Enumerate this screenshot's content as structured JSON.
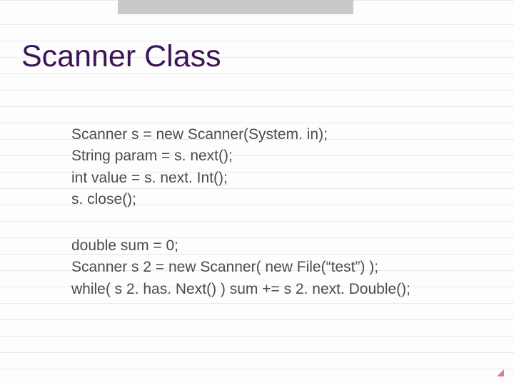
{
  "title": "Scanner Class",
  "code1": {
    "l1": "Scanner s = new Scanner(System. in);",
    "l2": "String param = s. next();",
    "l3": "int value = s. next. Int();",
    "l4": "s. close();"
  },
  "code2": {
    "l1": "double sum = 0;",
    "l2": "Scanner s 2 = new Scanner( new File(“test”) );",
    "l3": "while( s 2. has. Next() ) sum += s 2. next. Double();"
  }
}
